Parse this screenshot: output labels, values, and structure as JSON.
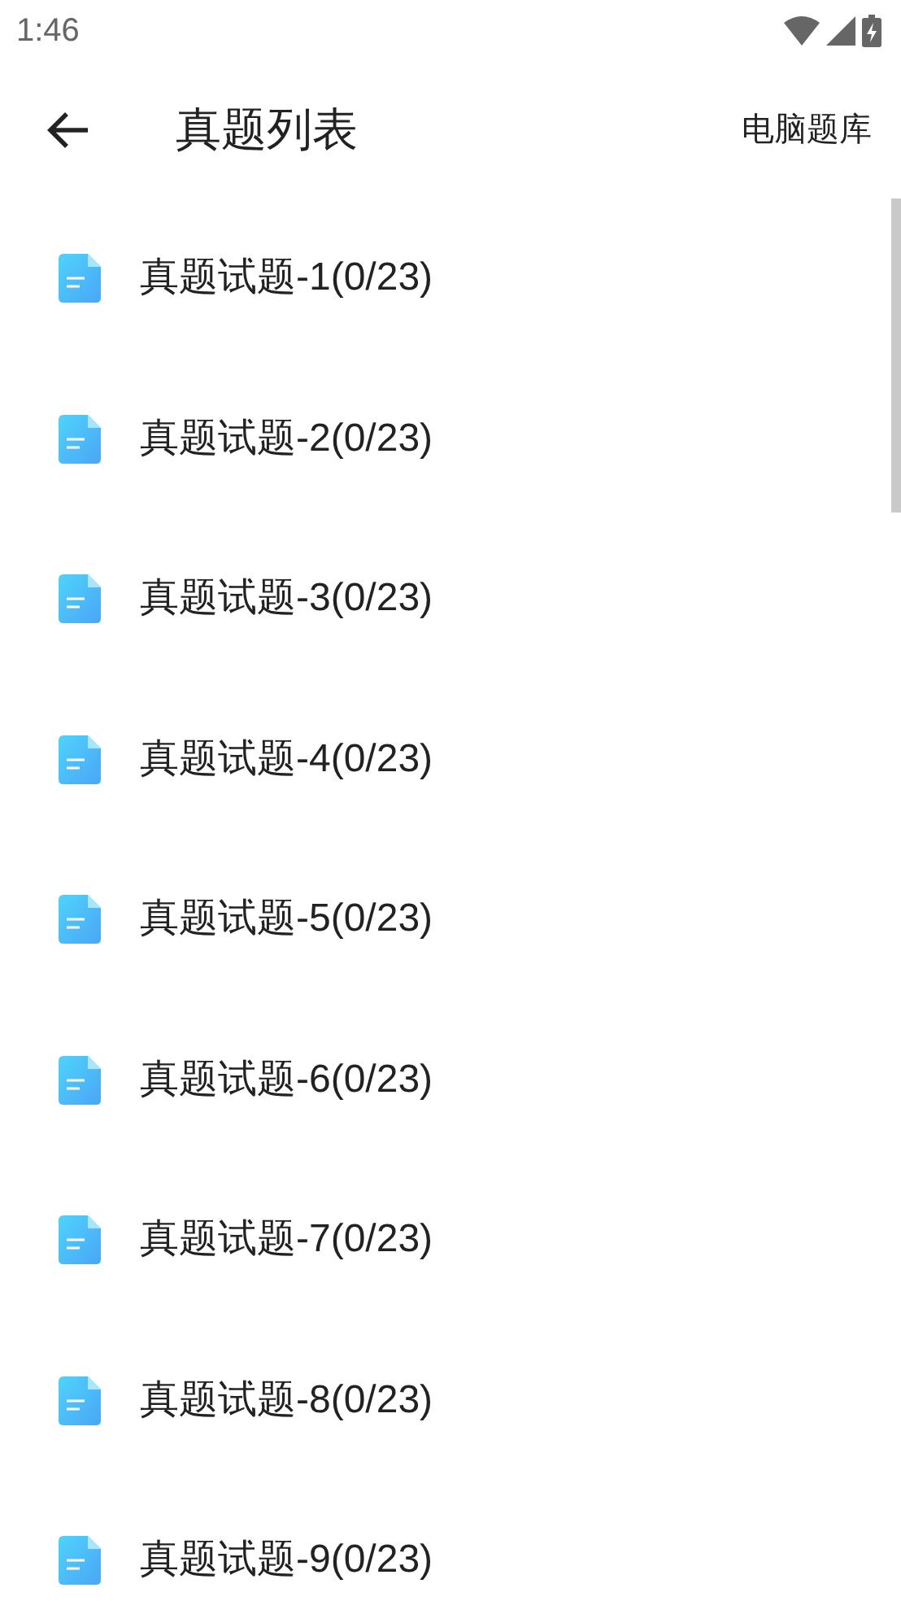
{
  "status_bar": {
    "time": "1:46"
  },
  "toolbar": {
    "title": "真题列表",
    "action": "电脑题库"
  },
  "items": [
    {
      "label": "真题试题-1(0/23)"
    },
    {
      "label": "真题试题-2(0/23)"
    },
    {
      "label": "真题试题-3(0/23)"
    },
    {
      "label": "真题试题-4(0/23)"
    },
    {
      "label": "真题试题-5(0/23)"
    },
    {
      "label": "真题试题-6(0/23)"
    },
    {
      "label": "真题试题-7(0/23)"
    },
    {
      "label": "真题试题-8(0/23)"
    },
    {
      "label": "真题试题-9(0/23)"
    }
  ]
}
